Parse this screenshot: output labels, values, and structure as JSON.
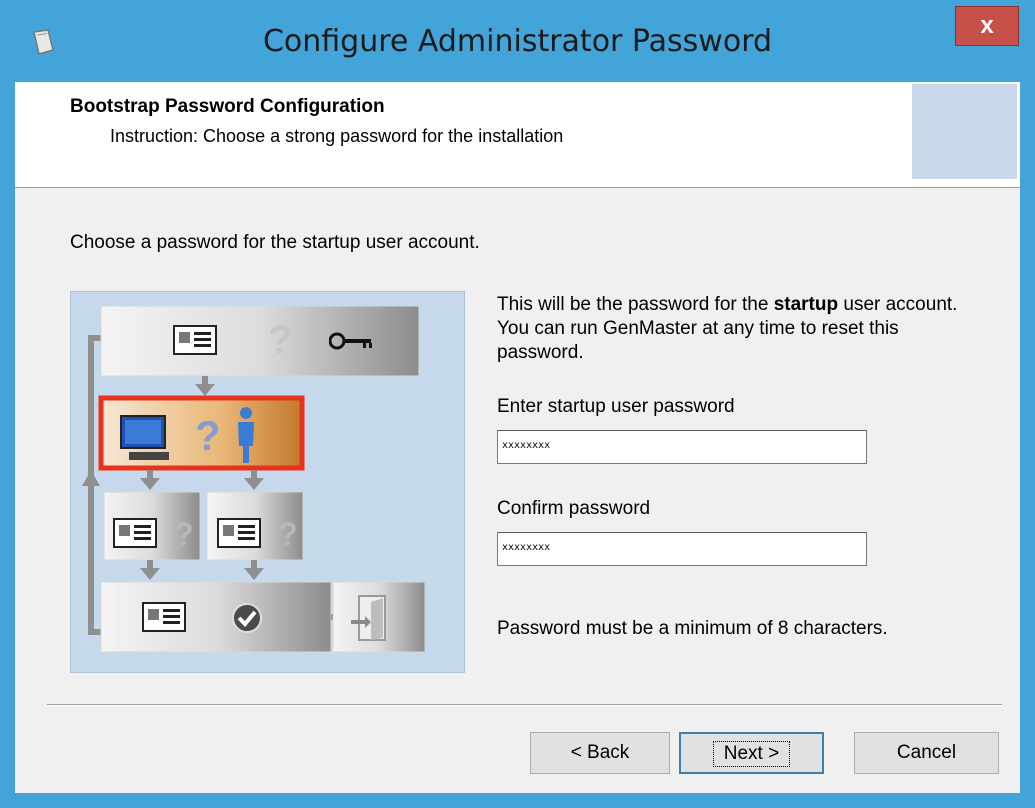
{
  "window": {
    "title": "Configure Administrator Password"
  },
  "header": {
    "title": "Bootstrap Password Configuration",
    "subtitle": "Instruction: Choose a strong password for the installation"
  },
  "body": {
    "prompt": "Choose a password for the startup user account.",
    "description_before": "This will be the password for the ",
    "description_bold": "startup",
    "description_after": " user account. You can run GenMaster at any time to reset this password.",
    "password_label": "Enter startup user password",
    "password_value": "xxxxxxxx",
    "confirm_label": "Confirm password",
    "confirm_value": "xxxxxxxx",
    "hint": "Password must be a minimum of 8 characters."
  },
  "illustration": {
    "question_glyph": "?"
  },
  "buttons": {
    "back": "< Back",
    "next": "Next >",
    "cancel": "Cancel"
  },
  "icons": {
    "app": "wizard-icon",
    "close": "close-icon",
    "key": "key-icon",
    "computer": "computer-icon",
    "person": "person-icon",
    "id_card": "id-card-icon",
    "checkmark": "checkmark-icon",
    "exit_door": "exit-door-icon"
  },
  "colors": {
    "titlebar": "#42a4d8",
    "close_button": "#c7504a",
    "highlight_border": "#e8321c",
    "illustration_bg": "#c6d9ec"
  }
}
